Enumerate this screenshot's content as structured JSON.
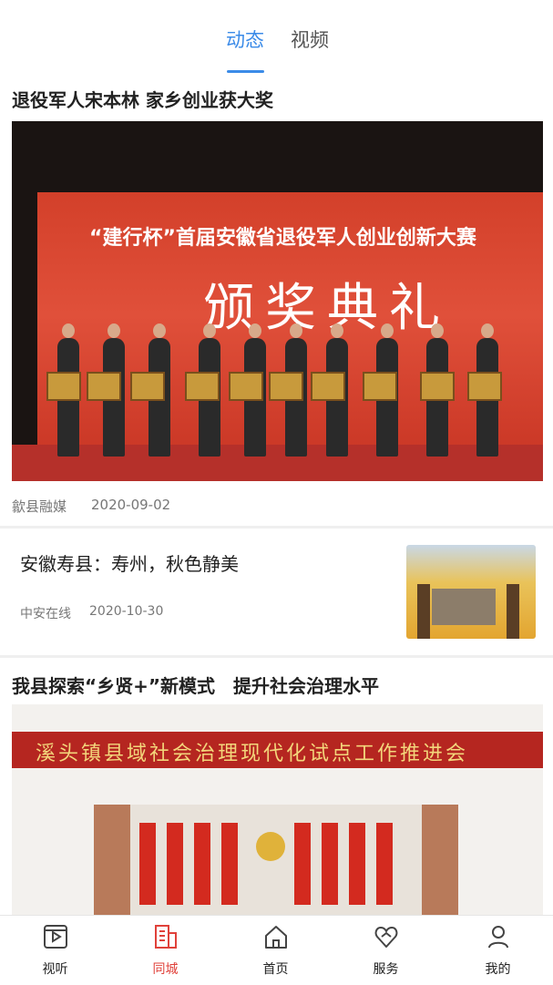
{
  "tabs": [
    {
      "label": "动态",
      "active": true
    },
    {
      "label": "视频",
      "active": false
    }
  ],
  "articles": [
    {
      "title": "退役军人宋本林 家乡创业获大奖",
      "source": "歙县融媒",
      "date": "2020-09-02",
      "image": {
        "banner_small": "“建行杯”首届安徽省退役军人创业创新大赛",
        "banner_big": "颁奖典礼"
      }
    },
    {
      "title": "安徽寿县：寿州，秋色静美",
      "source": "中安在线",
      "date": "2020-10-30"
    },
    {
      "title": "我县探索“乡贤+”新模式　提升社会治理水平",
      "image": {
        "banner": "溪头镇县域社会治理现代化试点工作推进会"
      }
    }
  ],
  "bottom_nav": [
    {
      "label": "视听",
      "icon": "video-icon",
      "active": false
    },
    {
      "label": "同城",
      "icon": "city-icon",
      "active": true
    },
    {
      "label": "首页",
      "icon": "home-icon",
      "active": false
    },
    {
      "label": "服务",
      "icon": "service-icon",
      "active": false
    },
    {
      "label": "我的",
      "icon": "user-icon",
      "active": false
    }
  ],
  "colors": {
    "accent": "#3b8be8",
    "nav_active": "#e0413a"
  }
}
